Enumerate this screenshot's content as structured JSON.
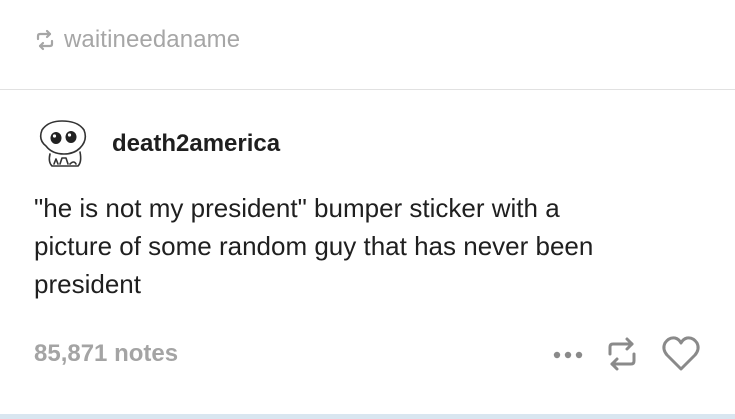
{
  "reblog": {
    "icon": "reblog-icon",
    "username": "waitineedaname"
  },
  "post": {
    "author": "death2america",
    "avatar": "cartoon-face-avatar",
    "lines": [
      "\"he is not my president\" bumper sticker with a",
      "picture of some random guy that has never been",
      "president"
    ]
  },
  "footer": {
    "notes": "85,871 notes",
    "icons": [
      "more-icon",
      "reblog-icon",
      "heart-icon"
    ]
  },
  "colors": {
    "muted_text": "#a6a6a6",
    "body_text": "#1f1f1f",
    "icon": "#8a8a8a"
  }
}
